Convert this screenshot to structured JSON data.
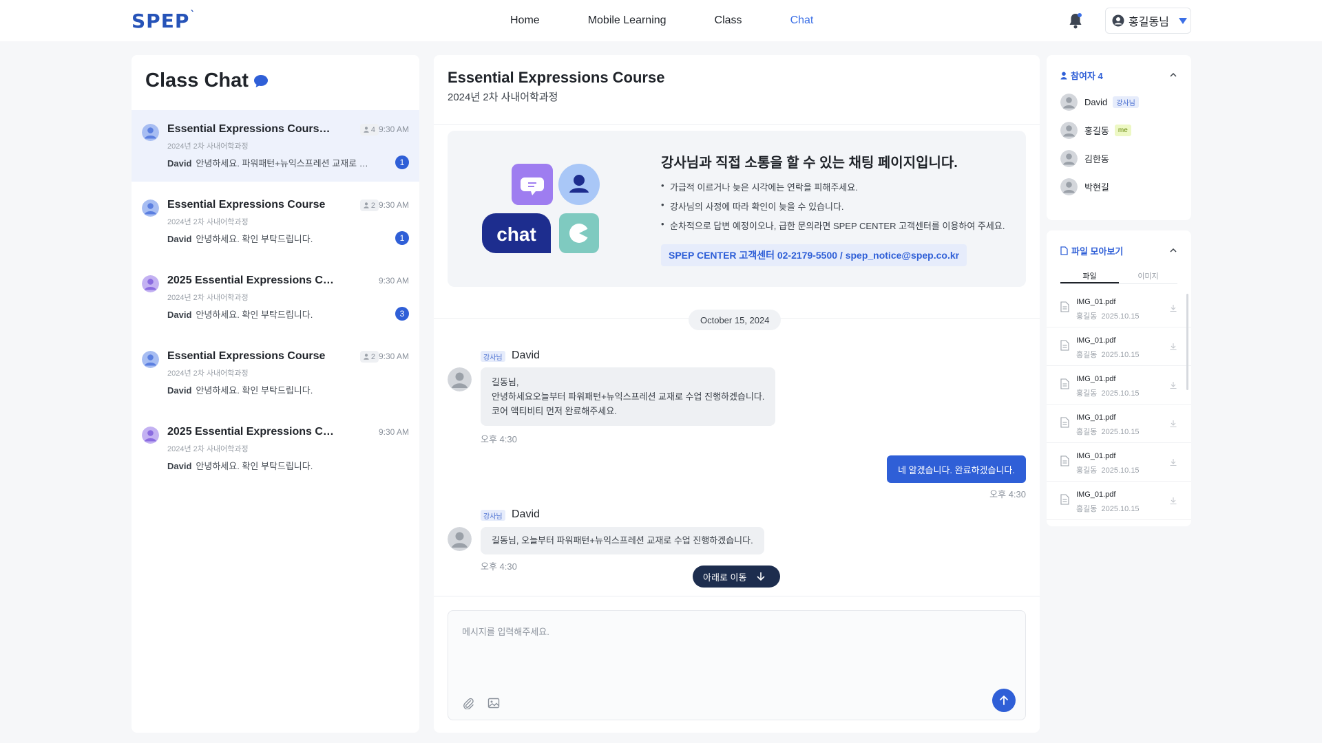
{
  "header": {
    "logo": "SPEP",
    "logo_mark": "`",
    "nav": [
      "Home",
      "Mobile Learning",
      "Class",
      "Chat"
    ],
    "active_nav": "Chat",
    "user_name": "홍길동님"
  },
  "sidebar": {
    "title": "Class Chat",
    "rooms": [
      {
        "name": "Essential Expressions Course Ex...",
        "members": "4",
        "time": "9:30 AM",
        "sub": "2024년 2차 사내어학과정",
        "sender": "David",
        "last": "안녕하세요. 파워패턴+뉴익스프레션 교재로 진...",
        "unread": "1"
      },
      {
        "name": "Essential Expressions Course",
        "members": "2",
        "time": "9:30 AM",
        "sub": "2024년 2차 사내어학과정",
        "sender": "David",
        "last": "안녕하세요. 확인 부탁드립니다.",
        "unread": "1"
      },
      {
        "name": "2025 Essential Expressions Course",
        "time": "9:30 AM",
        "sub": "2024년 2차 사내어학과정",
        "sender": "David",
        "last": "안녕하세요. 확인 부탁드립니다.",
        "unread": "3"
      },
      {
        "name": "Essential Expressions Course",
        "members": "2",
        "time": "9:30 AM",
        "sub": "2024년 2차 사내어학과정",
        "sender": "David",
        "last": "안녕하세요. 확인 부탁드립니다."
      },
      {
        "name": "2025 Essential Expressions Course",
        "time": "9:30 AM",
        "sub": "2024년 2차 사내어학과정",
        "sender": "David",
        "last": "안녕하세요. 확인 부탁드립니다."
      }
    ]
  },
  "chat": {
    "title": "Essential Expressions Course",
    "subtitle": "2024년 2차 사내어학과정",
    "notice": {
      "illustration_label": "chat",
      "title": "강사님과 직접 소통을 할 수 있는 채팅 페이지입니다.",
      "items": [
        "가급적 이르거나 늦은 시각에는 연락을 피해주세요.",
        "강사님의 사정에 따라 확인이 늦을 수 있습니다.",
        "순차적으로 답변 예정이오나, 급한 문의라면 SPEP CENTER 고객센터를 이용하여 주세요."
      ],
      "contact": "SPEP CENTER 고객센터 02-2179-5500 / spep_notice@spep.co.kr"
    },
    "date": "October 15, 2024",
    "messages": [
      {
        "role": "강사님",
        "sender": "David",
        "lines": [
          "길동님,",
          "안녕하세요오늘부터 파워패턴+뉴익스프레션 교재로 수업 진행하겠습니다.",
          "코어 액티비티 먼저 완료해주세요."
        ],
        "time": "오후 4:30"
      },
      {
        "text": "네 알겠습니다. 완료하겠습니다.",
        "time": "오후 4:30"
      },
      {
        "role": "강사님",
        "sender": "David",
        "lines": [
          "길동님, 오늘부터 파워패턴+뉴익스프레션 교재로 수업 진행하겠습니다."
        ],
        "time": "오후 4:30"
      }
    ],
    "scroll_down_label": "아래로 이동",
    "input_placeholder": "메시지를 입력해주세요."
  },
  "participants": {
    "title": "참여자 4",
    "list": [
      {
        "name": "David",
        "tag": "강사님"
      },
      {
        "name": "홍길동",
        "tag": "me"
      },
      {
        "name": "김한동"
      },
      {
        "name": "박현길"
      }
    ]
  },
  "files": {
    "title": "파일 모아보기",
    "tabs": [
      "파일",
      "이미지"
    ],
    "active_tab": "파일",
    "items": [
      {
        "name": "IMG_01.pdf",
        "owner": "홍길동",
        "date": "2025.10.15"
      },
      {
        "name": "IMG_01.pdf",
        "owner": "홍길동",
        "date": "2025.10.15"
      },
      {
        "name": "IMG_01.pdf",
        "owner": "홍길동",
        "date": "2025.10.15"
      },
      {
        "name": "IMG_01.pdf",
        "owner": "홍길동",
        "date": "2025.10.15"
      },
      {
        "name": "IMG_01.pdf",
        "owner": "홍길동",
        "date": "2025.10.15"
      },
      {
        "name": "IMG_01.pdf",
        "owner": "홍길동",
        "date": "2025.10.15"
      }
    ]
  },
  "colors": {
    "accent": "#2f5fd7",
    "brand": "#2653b8",
    "nav_active": "#3b6fe6",
    "scroll_button": "#1d2d4e"
  },
  "icons": [
    "bell-icon",
    "user-circle-icon",
    "speech-bubble-icon",
    "person-icon",
    "paperclip-icon",
    "image-icon",
    "arrow-up-icon",
    "arrow-down-icon",
    "file-icon",
    "download-icon",
    "chevron-up-icon"
  ]
}
